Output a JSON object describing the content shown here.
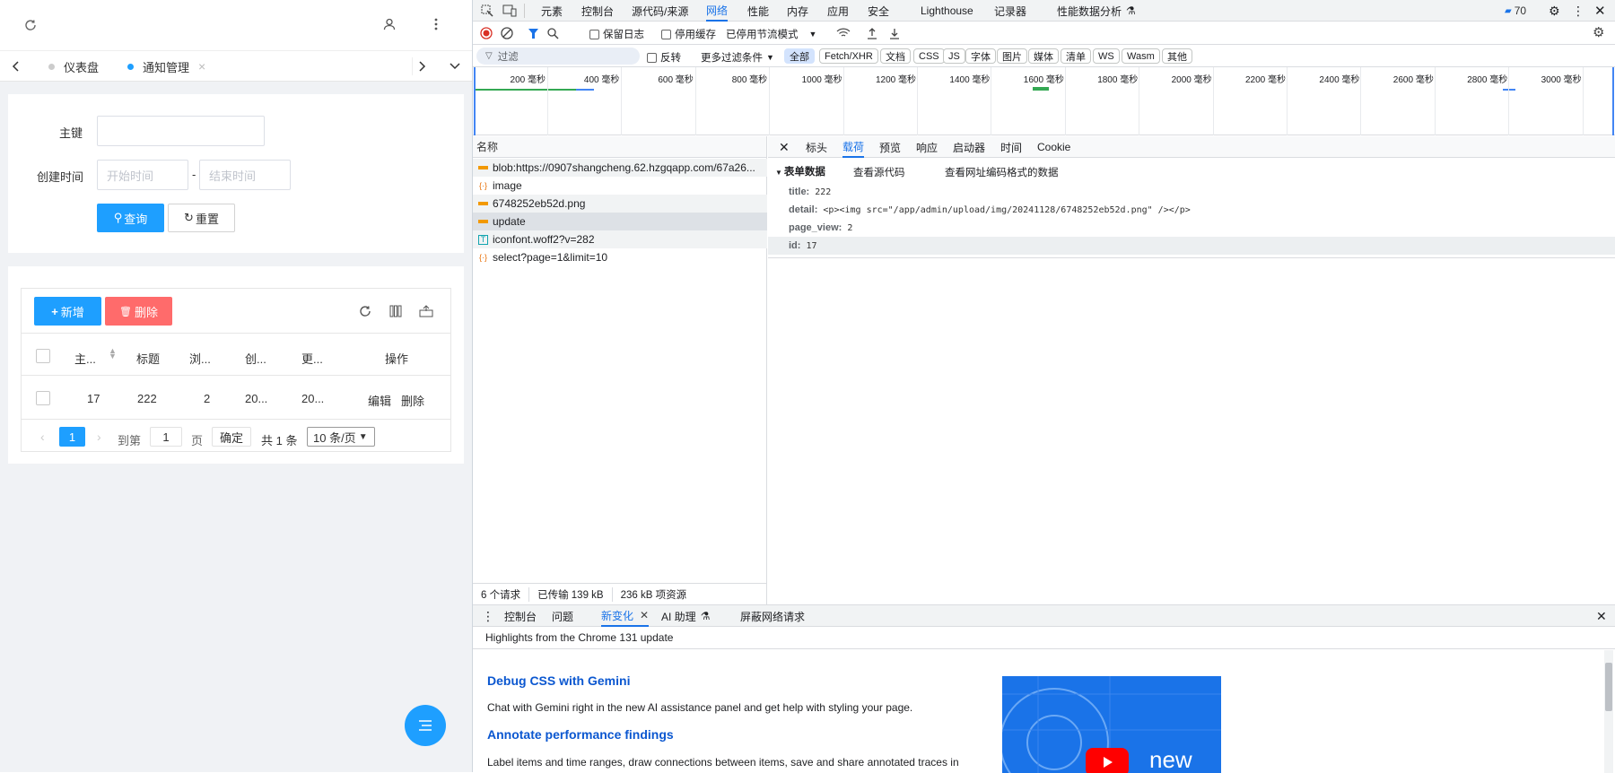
{
  "left": {
    "tabs": [
      {
        "label": "仪表盘",
        "active": false
      },
      {
        "label": "通知管理",
        "active": true
      }
    ],
    "form": {
      "key_label": "主键",
      "time_label": "创建时间",
      "start_placeholder": "开始时间",
      "end_placeholder": "结束时间",
      "separator": "-",
      "query_label": "查询",
      "reset_label": "重置"
    },
    "toolbar": {
      "add_label": "新增",
      "delete_label": "删除"
    },
    "table": {
      "headers": [
        "主...",
        "标题",
        "浏...",
        "创...",
        "更...",
        "操作"
      ],
      "rows": [
        {
          "id": "17",
          "title": "222",
          "views": "2",
          "created": "20...",
          "updated": "20...",
          "edit": "编辑",
          "del": "删除"
        }
      ]
    },
    "pager": {
      "page": "1",
      "goto_label": "到第",
      "goto_value": "1",
      "page_suffix": "页",
      "confirm": "确定",
      "total": "共 1 条",
      "size": "10 条/页"
    },
    "colors": {
      "primary": "#1e9fff",
      "danger": "#ff5722"
    }
  },
  "devtools": {
    "main_tabs": [
      "元素",
      "控制台",
      "源代码/来源",
      "网络",
      "性能",
      "内存",
      "应用",
      "安全",
      "Lighthouse",
      "记录器",
      "性能数据分析"
    ],
    "active_main_tab": "网络",
    "issues_count": "70",
    "toolbar": {
      "preserve_log": "保留日志",
      "disable_cache": "停用缓存",
      "throttle": "已停用节流模式"
    },
    "filter": {
      "placeholder": "过滤",
      "invert": "反转",
      "more": "更多过滤条件"
    },
    "types": [
      "全部",
      "Fetch/XHR",
      "文档",
      "CSS",
      "JS",
      "字体",
      "图片",
      "媒体",
      "清单",
      "WS",
      "Wasm",
      "其他"
    ],
    "ticks": [
      "200 毫秒",
      "400 毫秒",
      "600 毫秒",
      "800 毫秒",
      "1000 毫秒",
      "1200 毫秒",
      "1400 毫秒",
      "1600 毫秒",
      "1800 毫秒",
      "2000 毫秒",
      "2200 毫秒",
      "2400 毫秒",
      "2600 毫秒",
      "2800 毫秒",
      "3000 毫秒"
    ],
    "name_header": "名称",
    "requests": [
      {
        "name": "blob:https://0907shangcheng.62.hzgqapp.com/67a26...",
        "icon": "doc-icon"
      },
      {
        "name": "image",
        "icon": "xhr-icon"
      },
      {
        "name": "6748252eb52d.png",
        "icon": "img-icon"
      },
      {
        "name": "update",
        "icon": "doc-icon"
      },
      {
        "name": "iconfont.woff2?v=282",
        "icon": "font-icon"
      },
      {
        "name": "select?page=1&limit=10",
        "icon": "xhr-icon"
      }
    ],
    "detail_tabs": [
      "标头",
      "载荷",
      "预览",
      "响应",
      "启动器",
      "时间",
      "Cookie"
    ],
    "active_detail_tab": "载荷",
    "payload": {
      "section": "表单数据",
      "view_source": "查看源代码",
      "view_encoded": "查看网址编码格式的数据",
      "fields": [
        {
          "key": "title:",
          "value": "222"
        },
        {
          "key": "detail:",
          "value": "<p><img src=\"/app/admin/upload/img/20241128/6748252eb52d.png\" /></p>"
        },
        {
          "key": "page_view:",
          "value": "2"
        },
        {
          "key": "id:",
          "value": "17"
        }
      ]
    },
    "status": {
      "requests": "6 个请求",
      "transferred": "已传输 139 kB",
      "resources": "236 kB 项资源"
    },
    "drawer": {
      "tabs": [
        "控制台",
        "问题",
        "新变化",
        "AI 助理",
        "屏蔽网络请求"
      ],
      "active": "新变化",
      "highlight": "Highlights from the Chrome 131 update",
      "h1": "Debug CSS with Gemini",
      "p1": "Chat with Gemini right in the new AI assistance panel and get help with styling your page.",
      "h2": "Annotate performance findings",
      "p2": "Label items and time ranges, draw connections between items, save and share annotated traces in",
      "thumb_text": "new"
    }
  }
}
